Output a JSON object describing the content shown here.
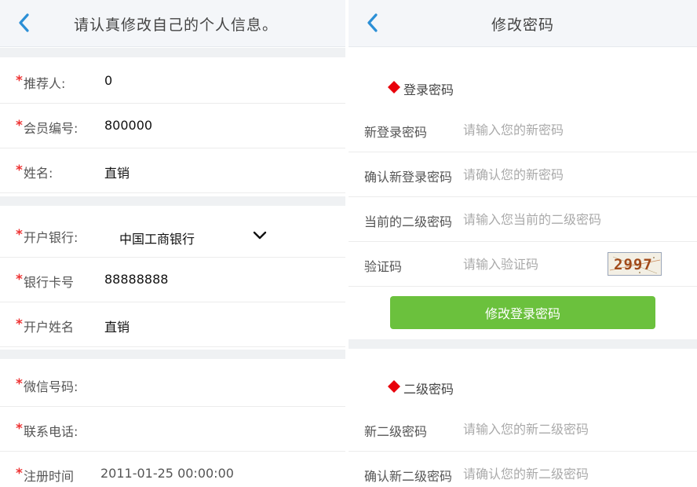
{
  "profile": {
    "header_title": "请认真修改自己的个人信息。",
    "required_mark": "*",
    "fields": [
      {
        "label": "推荐人:",
        "value": "0"
      },
      {
        "label": "会员编号:",
        "value": "800000"
      },
      {
        "label": "姓名:",
        "value": "直销"
      },
      {
        "label": "开户银行:",
        "value": "中国工商银行"
      },
      {
        "label": "银行卡号",
        "value": "88888888"
      },
      {
        "label": "开户姓名",
        "value": "直销"
      },
      {
        "label": "微信号码:",
        "value": ""
      },
      {
        "label": "联系电话:",
        "value": ""
      },
      {
        "label": "注册时间",
        "value": "2011-01-25 00:00:00"
      }
    ]
  },
  "password": {
    "header_title": "修改密码",
    "login_section": {
      "title": "登录密码",
      "fields": [
        {
          "label": "新登录密码",
          "placeholder": "请输入您的新密码"
        },
        {
          "label": "确认新登录密码",
          "placeholder": "请确认您的新密码"
        },
        {
          "label": "当前的二级密码",
          "placeholder": "请输入您当前的二级密码"
        },
        {
          "label": "验证码",
          "placeholder": "请输入验证码"
        }
      ],
      "captcha_text": "2997",
      "submit_label": "修改登录密码"
    },
    "secondary_section": {
      "title": "二级密码",
      "fields": [
        {
          "label": "新二级密码",
          "placeholder": "请输入您的新二级密码"
        },
        {
          "label": "确认新二级密码",
          "placeholder": "请确认您的新二级密码"
        }
      ]
    }
  },
  "colors": {
    "accent_blue": "#2b8fd6",
    "required_red": "#e33333",
    "diamond_red": "#e8000b",
    "button_green": "#6bc13d"
  }
}
